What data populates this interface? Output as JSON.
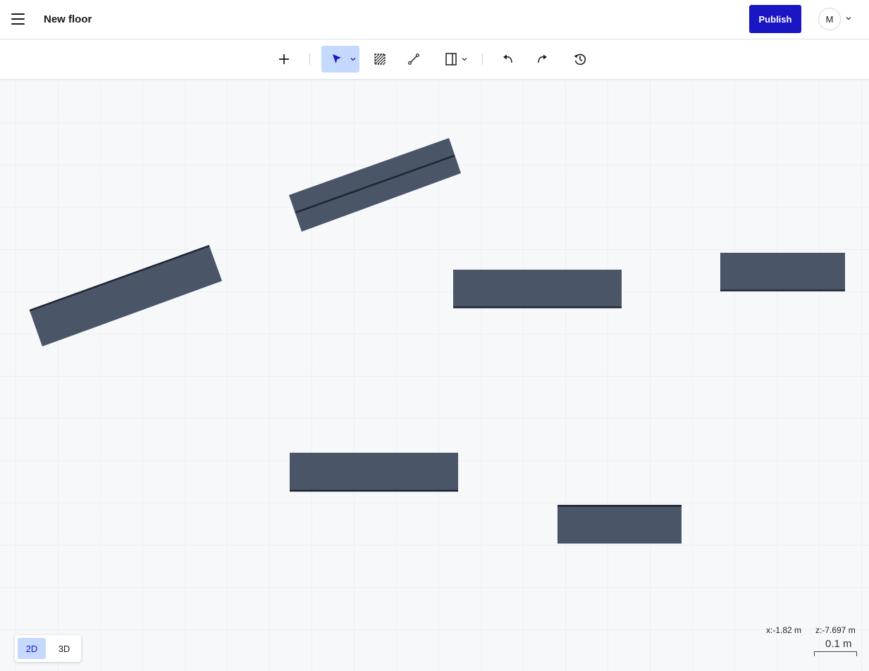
{
  "header": {
    "title": "New floor",
    "publish_label": "Publish",
    "avatar_initial": "M"
  },
  "toolbar": {
    "tools": [
      {
        "name": "add-tool",
        "icon": "plus-icon"
      },
      {
        "name": "select-tool",
        "icon": "cursor-arrow-icon",
        "active": true
      },
      {
        "name": "area-tool",
        "icon": "hatched-area-icon"
      },
      {
        "name": "line-tool",
        "icon": "line-segment-icon"
      },
      {
        "name": "door-tool",
        "icon": "door-icon"
      },
      {
        "name": "undo-tool",
        "icon": "undo-icon"
      },
      {
        "name": "redo-tool",
        "icon": "redo-icon"
      },
      {
        "name": "history-tool",
        "icon": "history-icon"
      }
    ]
  },
  "view_mode": {
    "options": [
      "2D",
      "3D"
    ],
    "selected": "2D"
  },
  "status": {
    "x_coord": "x:-1.82 m",
    "z_coord": "z:-7.697 m",
    "scale": "0.1 m"
  },
  "colors": {
    "accent": "#1a16c4",
    "wall_fill": "#4a5568",
    "wall_edge": "#1e2532",
    "active_tool_bg": "#c5d9ff",
    "grid_line": "#e6e9ee"
  }
}
